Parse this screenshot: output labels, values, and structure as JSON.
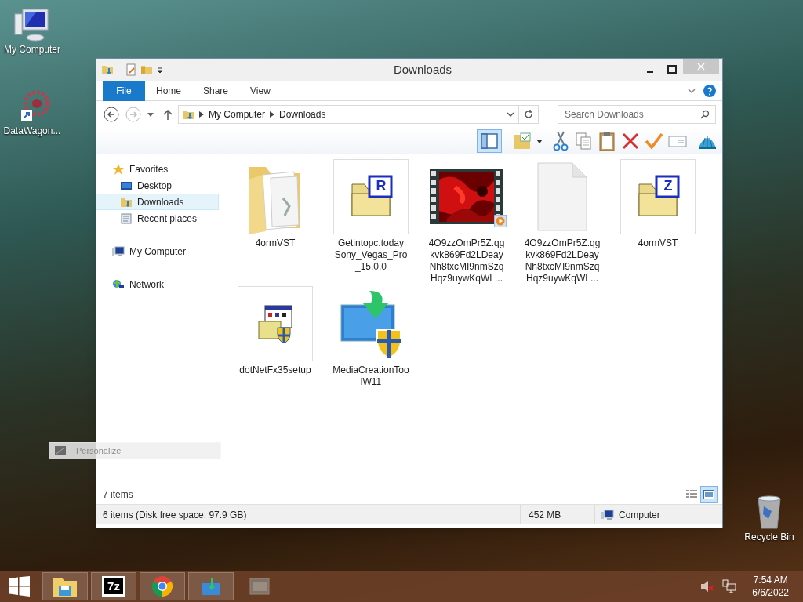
{
  "desktop_icons": [
    {
      "label": "My Computer",
      "kind": "computer"
    },
    {
      "label": "DataWagon...",
      "kind": "shortcut"
    },
    {
      "label": "Recycle Bin",
      "kind": "recycle"
    }
  ],
  "window": {
    "title": "Downloads",
    "ribbon_tabs": [
      {
        "label": "File",
        "kind": "file"
      },
      {
        "label": "Home",
        "kind": "tab"
      },
      {
        "label": "Share",
        "kind": "tab"
      },
      {
        "label": "View",
        "kind": "tab"
      }
    ],
    "address": {
      "crumbs": [
        "My Computer",
        "Downloads"
      ]
    },
    "search": {
      "placeholder": "Search Downloads"
    },
    "nav": [
      {
        "label": "Favorites",
        "kind": "favorites",
        "selected": false,
        "children": [
          {
            "label": "Desktop",
            "kind": "desktop",
            "selected": false
          },
          {
            "label": "Downloads",
            "kind": "downloads",
            "selected": true
          },
          {
            "label": "Recent places",
            "kind": "recent",
            "selected": false
          }
        ]
      },
      {
        "label": "My Computer",
        "kind": "computer",
        "selected": false
      },
      {
        "label": "Network",
        "kind": "network",
        "selected": false
      }
    ],
    "files": [
      {
        "name": "4ormVST",
        "kind": "folder"
      },
      {
        "name": "_Getintopc.today_Sony_Vegas_Pro_15.0.0",
        "kind": "archive",
        "badge": "R"
      },
      {
        "name": "4O9zzOmPr5Z.qgkvk869Fd2LDeayNh8txcMI9nmSzqHqz9uywKqWL...",
        "kind": "video"
      },
      {
        "name": "4O9zzOmPr5Z.qgkvk869Fd2LDeayNh8txcMI9nmSzqHqz9uywKqWL...",
        "kind": "blank"
      },
      {
        "name": "4ormVST",
        "kind": "archive",
        "badge": "Z"
      },
      {
        "name": "dotNetFx35setup",
        "kind": "installer"
      },
      {
        "name": "MediaCreationToolW11",
        "kind": "media"
      }
    ],
    "item_count": "7 items",
    "views": [
      {
        "kind": "details",
        "selected": false
      },
      {
        "kind": "large_icons",
        "selected": true
      }
    ],
    "status_bar": {
      "summary": "6 items (Disk free space: 97.9 GB)",
      "size": "452 MB",
      "location": "Computer"
    }
  },
  "ghost_menu": {
    "label": "Personalize"
  },
  "taskbar": {
    "apps": [
      {
        "kind": "explorer"
      },
      {
        "kind": "sevenzip",
        "label": "7z"
      },
      {
        "kind": "chrome"
      },
      {
        "kind": "media"
      },
      {
        "kind": "faded"
      }
    ],
    "tray": {
      "time": "7:54 AM",
      "date": "6/6/2022"
    }
  }
}
